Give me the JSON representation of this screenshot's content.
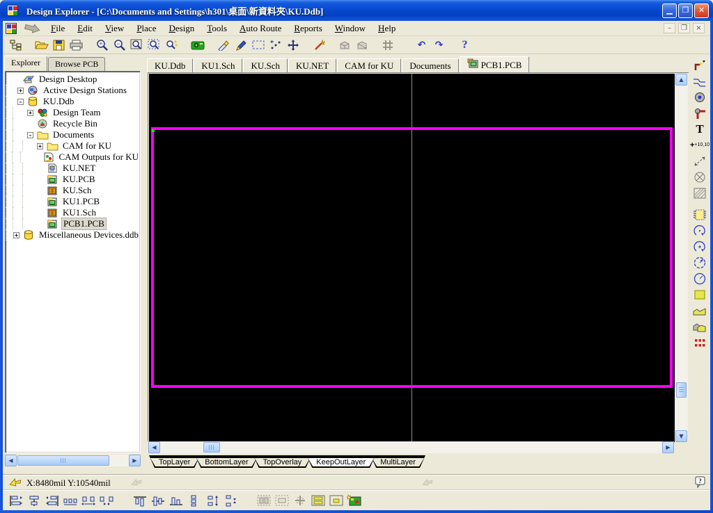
{
  "window": {
    "title": "Design Explorer - [C:\\Documents and Settings\\h301\\桌面\\新資料夾\\KU.Ddb]",
    "controls": {
      "minimize": "minimize",
      "maximize": "maximize",
      "close": "close"
    }
  },
  "menu_bar": {
    "items": [
      {
        "label": "File"
      },
      {
        "label": "Edit"
      },
      {
        "label": "View"
      },
      {
        "label": "Place"
      },
      {
        "label": "Design"
      },
      {
        "label": "Tools"
      },
      {
        "label": "Auto Route"
      },
      {
        "label": "Reports"
      },
      {
        "label": "Window"
      },
      {
        "label": "Help"
      }
    ],
    "mdi_controls": {
      "minimize": "–",
      "restore": "❐",
      "close": "×"
    }
  },
  "main_toolbar": {
    "icons": [
      "explorer-panel-toggle",
      "open-document",
      "save",
      "print",
      "zoom-in",
      "zoom-out",
      "zoom-window",
      "zoom-area",
      "zoom-point",
      "capture-view",
      "slice-tracks",
      "edit-route",
      "select-area",
      "move-object",
      "cross-move",
      "wizard",
      "gray-shape-1",
      "gray-shape-2",
      "toggle-grid",
      "undo",
      "redo",
      "help"
    ],
    "undo_glyph": "↶",
    "redo_glyph": "↷",
    "help_glyph": "?"
  },
  "explorer_panel": {
    "tabs": [
      {
        "label": "Explorer",
        "active": true
      },
      {
        "label": "Browse PCB",
        "active": false
      }
    ],
    "tree": [
      {
        "label": "Design Desktop",
        "icon": "design-desktop-icon",
        "level": 0,
        "expander": ""
      },
      {
        "label": "Active Design Stations",
        "icon": "design-stations-icon",
        "level": 1,
        "expander": "+"
      },
      {
        "label": "KU.Ddb",
        "icon": "database-icon",
        "level": 1,
        "expander": "-"
      },
      {
        "label": "Design Team",
        "icon": "design-team-icon",
        "level": 2,
        "expander": "+"
      },
      {
        "label": "Recycle Bin",
        "icon": "recycle-bin-icon",
        "level": 2,
        "expander": ""
      },
      {
        "label": "Documents",
        "icon": "folder-icon",
        "level": 2,
        "expander": "-"
      },
      {
        "label": "CAM for KU",
        "icon": "folder-icon",
        "level": 3,
        "expander": "+"
      },
      {
        "label": "CAM Outputs for KU",
        "icon": "cam-output-icon",
        "level": 3,
        "expander": ""
      },
      {
        "label": "KU.NET",
        "icon": "netlist-icon",
        "level": 3,
        "expander": ""
      },
      {
        "label": "KU.PCB",
        "icon": "pcb-doc-icon",
        "level": 3,
        "expander": ""
      },
      {
        "label": "KU.Sch",
        "icon": "sch-doc-icon",
        "level": 3,
        "expander": ""
      },
      {
        "label": "KU1.PCB",
        "icon": "pcb-doc-icon",
        "level": 3,
        "expander": ""
      },
      {
        "label": "KU1.Sch",
        "icon": "sch-doc-icon",
        "level": 3,
        "expander": ""
      },
      {
        "label": "PCB1.PCB",
        "icon": "pcb-doc-icon",
        "level": 3,
        "expander": "",
        "selected": true
      },
      {
        "label": "Miscellaneous Devices.ddb",
        "icon": "database-icon",
        "level": 1,
        "expander": "+"
      }
    ]
  },
  "document_tabs": [
    {
      "label": "KU.Ddb",
      "active": false
    },
    {
      "label": "KU1.Sch",
      "active": false
    },
    {
      "label": "KU.Sch",
      "active": false
    },
    {
      "label": "KU.NET",
      "active": false
    },
    {
      "label": "CAM for KU",
      "active": false
    },
    {
      "label": "Documents",
      "active": false
    },
    {
      "label": "PCB1.PCB",
      "active": true,
      "icon": "pcb-document-icon"
    }
  ],
  "editor": {
    "background": "#000000",
    "board_outline_color": "#FF00FF",
    "grid_line_color": "#8F8F8F",
    "origin_marker_color": "#00FF00"
  },
  "layer_tabs": [
    {
      "label": "TopLayer",
      "active": false
    },
    {
      "label": "BottomLayer",
      "active": false
    },
    {
      "label": "TopOverlay",
      "active": false
    },
    {
      "label": "KeepOutLayer",
      "active": true
    },
    {
      "label": "MultiLayer",
      "active": false
    }
  ],
  "placement_toolbar": {
    "icons": [
      "place-track",
      "place-interactive-route",
      "place-pad",
      "place-via",
      "place-string",
      "place-coordinate",
      "place-dimension",
      "place-keepout",
      "place-fill-hatched",
      "place-component",
      "place-arc-edge",
      "place-arc-center",
      "place-arc-angle",
      "place-full-circle",
      "place-fill",
      "place-polygon",
      "place-paste-shapes",
      "place-pad-array"
    ],
    "string_glyph": "T",
    "coordinate_glyph": "+10,10"
  },
  "status_bar": {
    "coordinates": "X:8480mil Y:10540mil"
  },
  "component_toolbar": {
    "icons": [
      "align-left",
      "align-center-horizontal",
      "align-right",
      "distribute-horizontal",
      "increase-horizontal-spacing",
      "decrease-horizontal-spacing",
      "align-top",
      "align-center-vertical",
      "align-bottom",
      "distribute-vertical",
      "increase-vertical-spacing",
      "decrease-vertical-spacing",
      "arrange-within-room",
      "placement-room",
      "arrange-on-grid",
      "arrange-within-rectangle",
      "shove-components",
      "density-map"
    ]
  }
}
